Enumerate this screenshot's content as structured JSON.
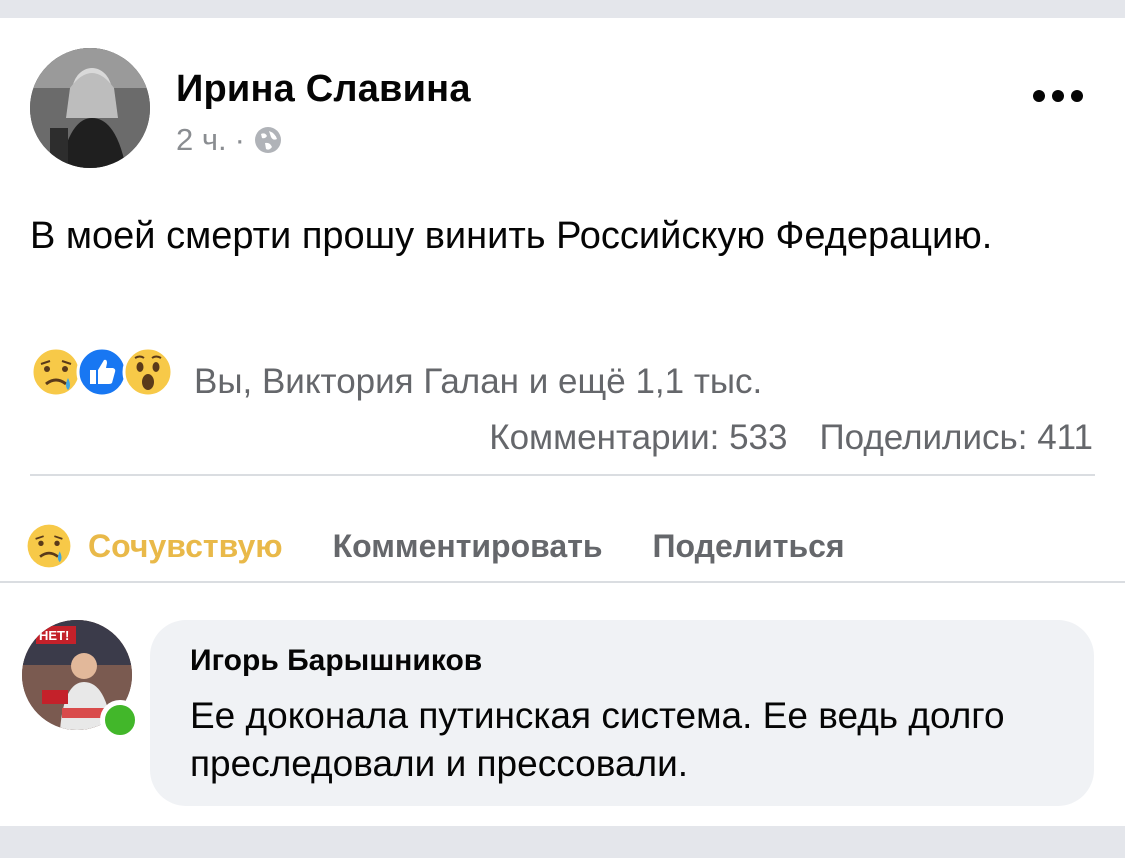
{
  "post": {
    "author": "Ирина Славина",
    "time": "2 ч.",
    "separator": "·",
    "text": "В моей смерти прошу винить Российскую Федерацию.",
    "privacy_icon": "globe-icon"
  },
  "reactions": {
    "icons": [
      "sad-reaction-icon",
      "like-reaction-icon",
      "wow-reaction-icon"
    ],
    "summary": "Вы, Виктория Галан и ещё 1,1 тыс.",
    "comments": "Комментарии: 533",
    "shares": "Поделились: 411"
  },
  "actions": {
    "react_label": "Сочувствую",
    "comment_label": "Комментировать",
    "share_label": "Поделиться"
  },
  "comment": {
    "author": "Игорь Барышников",
    "text": "Ее доконала путинская система. Ее ведь долго преследовали и прессовали.",
    "avatar_sign": "НЕТ!"
  },
  "colors": {
    "background": "#e4e6eb",
    "card": "#ffffff",
    "text": "#050505",
    "secondary": "#65676b",
    "accent_sad": "#e9b949",
    "like_blue": "#1877f2",
    "online": "#42b72a",
    "bubble": "#f0f2f5"
  }
}
